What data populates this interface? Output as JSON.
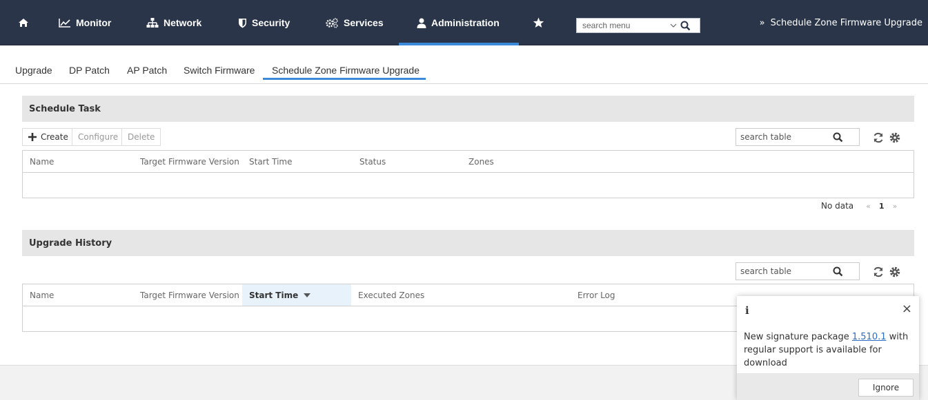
{
  "nav": {
    "items": [
      {
        "label": "Monitor",
        "icon": "chart-line-icon"
      },
      {
        "label": "Network",
        "icon": "network-icon"
      },
      {
        "label": "Security",
        "icon": "shield-icon"
      },
      {
        "label": "Services",
        "icon": "gears-icon"
      },
      {
        "label": "Administration",
        "icon": "user-icon"
      }
    ],
    "active": "Administration",
    "search_placeholder": "search menu",
    "breadcrumb_arrow": "»",
    "breadcrumb": "Schedule Zone Firmware Upgrade",
    "colors": {
      "bg": "#2a3549",
      "accent": "#3b8ad9"
    }
  },
  "subtabs": {
    "items": [
      "Upgrade",
      "DP Patch",
      "AP Patch",
      "Switch Firmware",
      "Schedule Zone Firmware Upgrade"
    ],
    "active": "Schedule Zone Firmware Upgrade"
  },
  "schedule": {
    "title": "Schedule Task",
    "buttons": {
      "create": "Create",
      "configure": "Configure",
      "delete": "Delete"
    },
    "search_placeholder": "search table",
    "columns": [
      "Name",
      "Target Firmware Version",
      "Start Time",
      "Status",
      "Zones"
    ],
    "rows": [],
    "pager": {
      "status": "No data",
      "prev": "«",
      "page": "1",
      "next": "»"
    }
  },
  "history": {
    "title": "Upgrade History",
    "search_placeholder": "search table",
    "columns": [
      "Name",
      "Target Firmware Version",
      "Start Time",
      "Executed Zones",
      "Error Log"
    ],
    "sorted_column": "Start Time",
    "rows": []
  },
  "notification": {
    "icon": "i",
    "close": "×",
    "msg_prefix": "New signature package ",
    "version": "1.510.1",
    "msg_suffix": " with regular support is available for download",
    "ignore": "Ignore"
  }
}
